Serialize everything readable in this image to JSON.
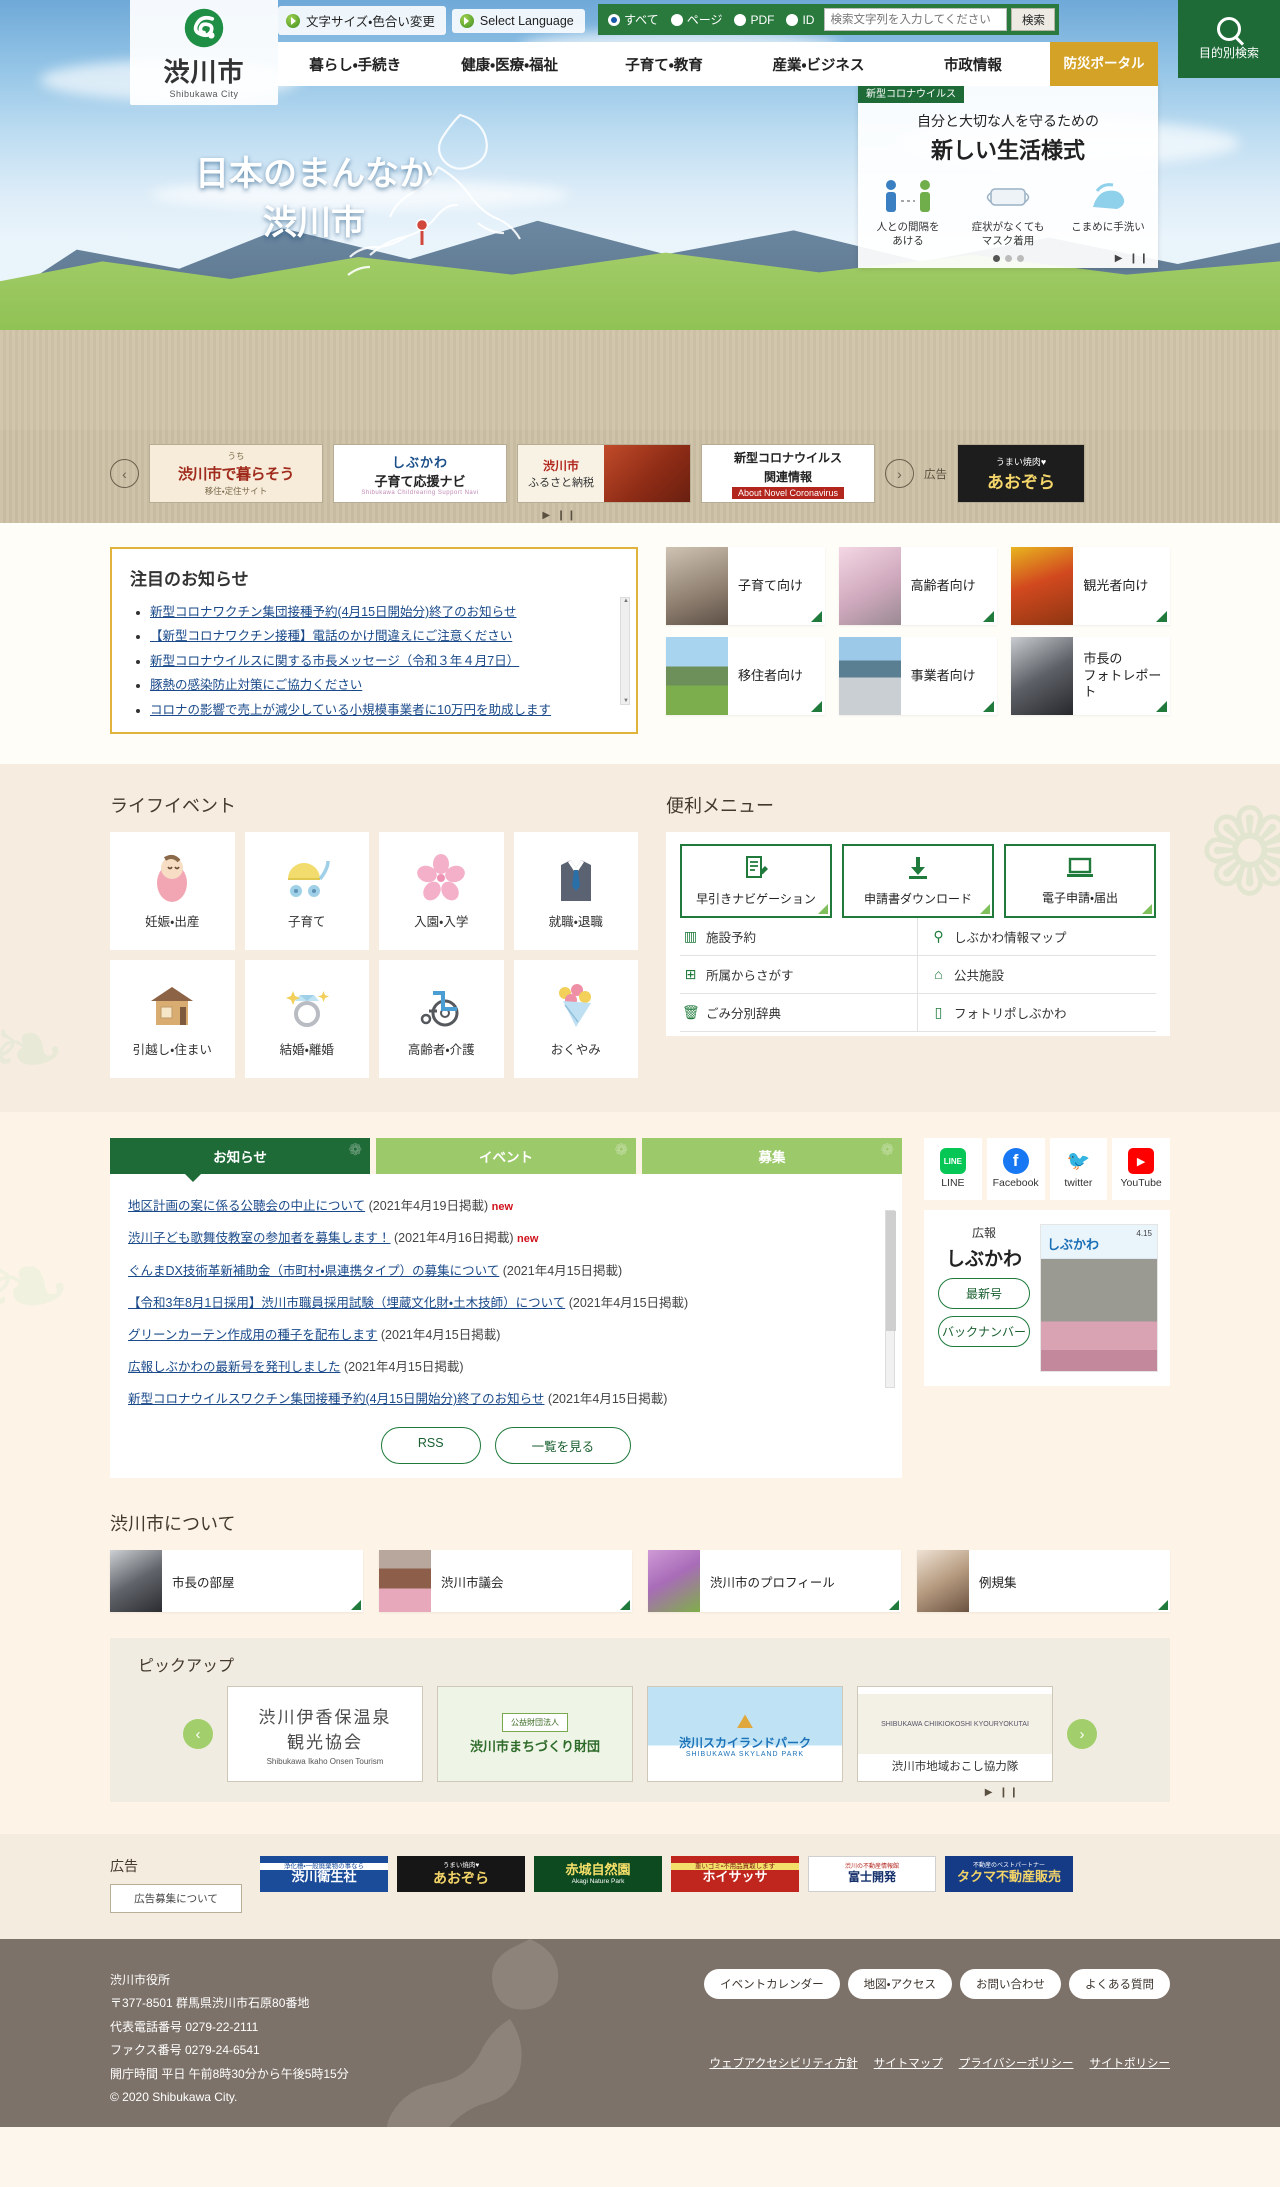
{
  "header": {
    "logo_title": "渋川市",
    "logo_sub": "Shibukawa City",
    "logo_icon": "shibukawa-crest-icon",
    "util_buttons": [
      {
        "label": "文字サイズ・色合い変更",
        "icon": "arrow-circle-icon"
      },
      {
        "label": "Select Language",
        "icon": "arrow-circle-icon"
      }
    ],
    "search": {
      "radios": [
        {
          "label": "すべて",
          "selected": true
        },
        {
          "label": "ページ",
          "selected": false
        },
        {
          "label": "PDF",
          "selected": false
        },
        {
          "label": "ID",
          "selected": false
        }
      ],
      "placeholder": "検索文字列を入力してください",
      "value": "",
      "button_label": "検索"
    },
    "purpose_button": {
      "label": "目的別検索",
      "icon": "magnifier-icon"
    },
    "gnav": [
      "暮らし・手続き",
      "健康・医療・福祉",
      "子育て・教育",
      "産業・ビジネス",
      "市政情報"
    ],
    "gnav_highlight": "防災ポータル"
  },
  "hero": {
    "copy_line1": "日本のまんなか",
    "copy_line2": "渋川市",
    "map_icon": "japan-map-icon",
    "corona": {
      "tag": "新型コロナウイルス",
      "title_small": "自分と大切な人を守るための",
      "title_large": "新しい生活様式",
      "items": [
        {
          "icon": "two-people-distance-icon",
          "label": "人との間隔を\nあける"
        },
        {
          "icon": "face-mask-icon",
          "label": "症状がなくても\nマスク着用"
        },
        {
          "icon": "hand-wash-icon",
          "label": "こまめに手洗い"
        }
      ],
      "dots": [
        true,
        false,
        false
      ],
      "controls": "▶ ❙❙"
    }
  },
  "banner_carousel": {
    "prev_icon": "chevron-left-icon",
    "next_icon": "chevron-right-icon",
    "slides": [
      {
        "name": "ijyu-banner",
        "title_ruby": "うち",
        "title": "渋川市で暮らそう",
        "sub": "移住・定住サイト"
      },
      {
        "name": "kosodate-banner",
        "line1": "しぶかわ",
        "line2": "子育て応援ナビ",
        "sub": "Shibukawa Childrearing Support Navi"
      },
      {
        "name": "furusato-banner",
        "line1": "渋川市",
        "line2": "ふるさと納税"
      },
      {
        "name": "corona-banner",
        "line1": "新型コロナウイルス",
        "line2": "関連情報",
        "sub": "About Novel Coronavirus"
      }
    ],
    "play_controls": "▶ ❙❙",
    "ad_label": "広告",
    "ad_slide": {
      "name": "aozora-ad",
      "line1": "うまい焼肉♥",
      "line2": "あおぞら"
    }
  },
  "notice": {
    "heading": "注目のお知らせ",
    "items": [
      "新型コロナワクチン集団接種予約(4月15日開始分)終了のお知らせ",
      "【新型コロナワクチン接種】電話のかけ間違えにご注意ください",
      "新型コロナウイルスに関する市長メッセージ（令和３年４月7日）",
      "豚熱の感染防止対策にご協力ください",
      "コロナの影響で売上が減少している小規模事業者に10万円を助成します"
    ]
  },
  "categories": [
    {
      "label": "子育て向け",
      "thumb": "family-baby-photo",
      "cls": "t-kosodate"
    },
    {
      "label": "高齢者向け",
      "thumb": "elderly-couple-photo",
      "cls": "t-korei"
    },
    {
      "label": "観光者向け",
      "thumb": "autumn-bridge-photo",
      "cls": "t-kanko"
    },
    {
      "label": "移住者向け",
      "thumb": "mountain-field-photo",
      "cls": "t-ijyu"
    },
    {
      "label": "事業者向け",
      "thumb": "city-industry-photo",
      "cls": "t-jigyo"
    },
    {
      "label": "市長の\nフォトレポート",
      "thumb": "mayor-photo",
      "cls": "t-shicho"
    }
  ],
  "life_event": {
    "heading": "ライフイベント",
    "items": [
      {
        "label": "妊娠・出産",
        "icon": "baby-icon",
        "glyph": "👶"
      },
      {
        "label": "子育て",
        "icon": "stroller-icon",
        "glyph": "🛒"
      },
      {
        "label": "入園・入学",
        "icon": "cherry-blossom-icon",
        "glyph": "🌸"
      },
      {
        "label": "就職・退職",
        "icon": "suit-necktie-icon",
        "glyph": "👔"
      },
      {
        "label": "引越し・住まい",
        "icon": "house-icon",
        "glyph": "🏠"
      },
      {
        "label": "結婚・離婚",
        "icon": "ring-icon",
        "glyph": "💍"
      },
      {
        "label": "高齢者・介護",
        "icon": "wheelchair-icon",
        "glyph": "♿"
      },
      {
        "label": "おくやみ",
        "icon": "flower-bouquet-icon",
        "glyph": "💐"
      }
    ]
  },
  "convenient_menu": {
    "heading": "便利メニュー",
    "buttons": [
      {
        "label": "早引きナビゲーション",
        "icon": "document-pencil-icon",
        "glyph": "🗒"
      },
      {
        "label": "申請書ダウンロード",
        "icon": "download-arrow-icon",
        "glyph": "⬇"
      },
      {
        "label": "電子申請・届出",
        "icon": "laptop-icon",
        "glyph": "💻"
      }
    ],
    "links": [
      {
        "label": "施設予約",
        "icon": "building-grid-icon",
        "glyph": "🏢"
      },
      {
        "label": "しぶかわ情報マップ",
        "icon": "map-pin-icon",
        "glyph": "🗺"
      },
      {
        "label": "所属からさがす",
        "icon": "org-chart-icon",
        "glyph": "🏛"
      },
      {
        "label": "公共施設",
        "icon": "public-facility-icon",
        "glyph": "🏫"
      },
      {
        "label": "ごみ分別辞典",
        "icon": "trash-bin-icon",
        "glyph": "🗑"
      },
      {
        "label": "フォトリポしぶかわ",
        "icon": "smartphone-icon",
        "glyph": "📱"
      }
    ]
  },
  "news": {
    "tabs": [
      {
        "label": "お知らせ",
        "active": true
      },
      {
        "label": "イベント",
        "active": false
      },
      {
        "label": "募集",
        "active": false
      }
    ],
    "items": [
      {
        "title": "地区計画の案に係る公聴会の中止について",
        "date": "(2021年4月19日掲載)",
        "new": "new"
      },
      {
        "title": "渋川子ども歌舞伎教室の参加者を募集します！",
        "date": "(2021年4月16日掲載)",
        "new": "new"
      },
      {
        "title": "ぐんまDX技術革新補助金（市町村・県連携タイプ）の募集について",
        "date": "(2021年4月15日掲載)",
        "new": ""
      },
      {
        "title": "【令和3年8月1日採用】渋川市職員採用試験（埋蔵文化財・土木技師）について",
        "date": "(2021年4月15日掲載)",
        "new": ""
      },
      {
        "title": "グリーンカーテン作成用の種子を配布します",
        "date": "(2021年4月15日掲載)",
        "new": ""
      },
      {
        "title": "広報しぶかわの最新号を発刊しました",
        "date": "(2021年4月15日掲載)",
        "new": ""
      },
      {
        "title": "新型コロナウイルスワクチン集団接種予約(4月15日開始分)終了のお知らせ",
        "date": "(2021年4月15日掲載)",
        "new": ""
      }
    ],
    "buttons": [
      {
        "label": "RSS"
      },
      {
        "label": "一覧を見る"
      }
    ]
  },
  "sns": [
    {
      "label": "LINE",
      "icon": "line-icon",
      "color": "#06c755",
      "glyph": "LINE"
    },
    {
      "label": "Facebook",
      "icon": "facebook-icon",
      "color": "#1877f2",
      "glyph": "f"
    },
    {
      "label": "twitter",
      "icon": "twitter-bird-icon",
      "color": "#1da1f2",
      "glyph": "🐦"
    },
    {
      "label": "YouTube",
      "icon": "youtube-icon",
      "color": "#ff0000",
      "glyph": "▶"
    }
  ],
  "kouhou": {
    "label_small": "広報",
    "label_large": "しぶかわ",
    "buttons": [
      {
        "label": "最新号"
      },
      {
        "label": "バックナンバー"
      }
    ],
    "cover": {
      "title": "しぶかわ",
      "date": "4.15",
      "thumb": "kouhou-cover-torch-relay-photo"
    }
  },
  "about": {
    "heading": "渋川市について",
    "items": [
      {
        "label": "市長の部屋",
        "thumb": "mayor-portrait-photo",
        "cls": "th1"
      },
      {
        "label": "渋川市議会",
        "thumb": "council-chamber-photo",
        "cls": "th2"
      },
      {
        "label": "渋川市のプロフィール",
        "thumb": "hydrangea-photo",
        "cls": "th3"
      },
      {
        "label": "例規集",
        "thumb": "law-books-photo",
        "cls": "th4"
      }
    ]
  },
  "pickup": {
    "heading": "ピックアップ",
    "prev_icon": "chevron-left-circle-icon",
    "next_icon": "chevron-right-circle-icon",
    "play_controls": "▶ ❙❙",
    "slides": [
      {
        "name": "ikaho-onsen-tourism",
        "l1": "渋川伊香保温泉",
        "l2": "観光協会",
        "l3": "Shibukawa Ikaho Onsen Tourism"
      },
      {
        "name": "machizukuri-zaidan",
        "box": "公益財団法人",
        "t": "渋川市まちづくり財団"
      },
      {
        "name": "skyland-park",
        "t": "渋川スカイランドパーク",
        "s": "SHIBUKAWA SKYLAND PARK"
      },
      {
        "name": "chiiki-okoshi-kyouryokutai",
        "map": "SHIBUKAWA CHIIKIOKOSHI KYOURYOKUTAI",
        "t": "渋川市地域おこし協力隊"
      }
    ]
  },
  "ads": {
    "heading": "広告",
    "recruit_label": "広告募集について",
    "items": [
      {
        "name": "shibukawa-eiseisha-ad",
        "cls": "a1",
        "s": "浄化槽・一般廃棄物の事なら",
        "m": "渋川衛生社"
      },
      {
        "name": "aozora-yakiniku-ad",
        "cls": "a2",
        "s": "うまい焼肉♥",
        "m": "あおぞら"
      },
      {
        "name": "akagi-nature-park-ad",
        "cls": "a3",
        "m": "赤城自然園",
        "s": "Akagi Nature Park"
      },
      {
        "name": "hoisassa-ad",
        "cls": "a4",
        "s": "重いゴミ・不用品買取します",
        "m": "ホイサッサ"
      },
      {
        "name": "fujimi-kaihatsu-ad",
        "cls": "a5",
        "s": "渋川の不動産情報館",
        "m": "富士開発"
      },
      {
        "name": "takuma-fudosan-ad",
        "cls": "a6",
        "s": "不動産のベストパートナー",
        "m": "タクマ不動産販売"
      }
    ]
  },
  "footer": {
    "map_icon": "japan-silhouette-icon",
    "address": [
      "渋川市役所",
      "〒377-8501 群馬県渋川市石原80番地",
      "代表電話番号 0279-22-2111",
      "ファクス番号 0279-24-6541",
      "開庁時間 平日 午前8時30分から午後5時15分",
      "© 2020 Shibukawa City."
    ],
    "buttons": [
      "イベントカレンダー",
      "地図・アクセス",
      "お問い合わせ",
      "よくある質問"
    ],
    "links": [
      "ウェブアクセシビリティ方針",
      "サイトマップ",
      "プライバシーポリシー",
      "サイトポリシー"
    ]
  }
}
